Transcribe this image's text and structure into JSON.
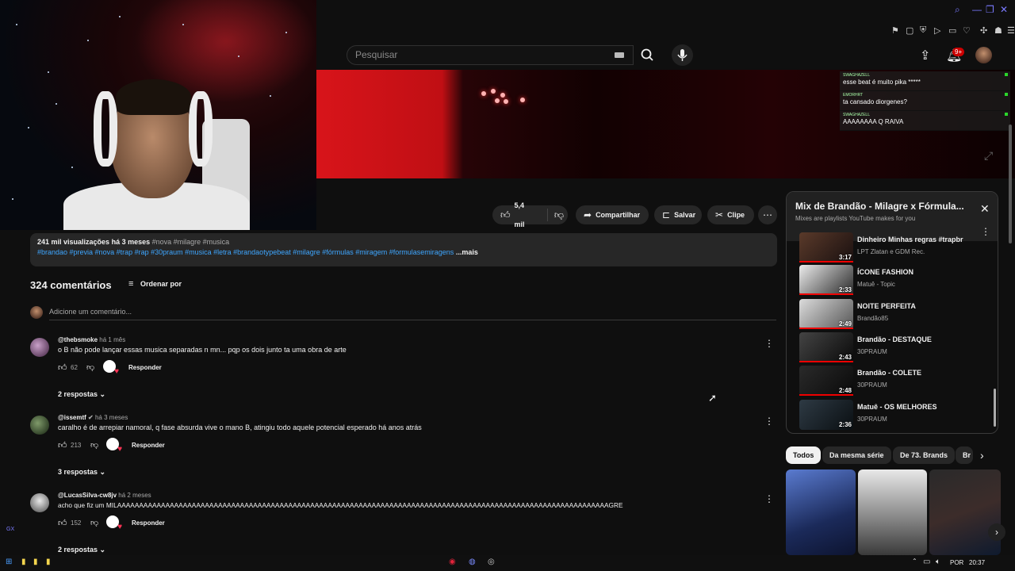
{
  "header": {
    "search_placeholder": "Pesquisar",
    "notification_count": "9+"
  },
  "chat_overlay": [
    {
      "user": "SWAGHAZELL",
      "text": "esse beat é muito pika *****"
    },
    {
      "user": "EMORHRT",
      "text": "ta cansado diorgenes?"
    },
    {
      "user": "SWAGHAZELL",
      "text": "AAAAAAAA Q RAIVA"
    }
  ],
  "actions": {
    "like_count": "5,4 mil",
    "share": "Compartilhar",
    "save": "Salvar",
    "clip": "Clipe"
  },
  "description": {
    "views": "241 mil visualizações",
    "age": "há 3 meses",
    "tags_top": "#nova #milagre #musica",
    "hashtags": "#brandao #previa #nova #trap #rap #30praum #musica #letra #brandaotypebeat #milagre #fórmulas #miragem #formulasemiragens",
    "more": "...mais"
  },
  "comments_section": {
    "count_label": "324 comentários",
    "sort_label": "Ordenar por",
    "add_placeholder": "Adicione um comentário..."
  },
  "comments": [
    {
      "user": "@thebsmoke",
      "ago": "há 1 mês",
      "text": "o B não pode lançar essas musica separadas n mn... pqp os dois junto ta uma obra de arte",
      "likes": "62",
      "reply_label": "Responder",
      "replies_label": "2 respostas"
    },
    {
      "user": "@issemtf",
      "ago": "há 3 meses",
      "text": "caralho é de arrepiar namoral, q fase absurda vive o mano B, atingiu todo aquele potencial esperado há anos atrás",
      "likes": "213",
      "reply_label": "Responder",
      "replies_label": "3 respostas"
    },
    {
      "user": "@LucasSilva-cw8jv",
      "ago": "há 2 meses",
      "text": "acho que fiz um MILAAAAAAAAAAAAAAAAAAAAAAAAAAAAAAAAAAAAAAAAAAAAAAAAAAAAAAAAAAAAAAAAAAAAAAAAAAAAAAAAAAAAAAAAAAAAAAAAAAAAAAAAAAAAAAAAGRE",
      "likes": "152",
      "reply_label": "Responder",
      "replies_label": "2 respostas"
    }
  ],
  "playlist": {
    "title": "Mix de Brandão - Milagre x Fórmula...",
    "subtitle": "Mixes are playlists YouTube makes for you",
    "items": [
      {
        "title": "Dinheiro Minhas regras #trapbr",
        "channel": "LPT Zlatan e GDM Rec.",
        "duration": "3:17"
      },
      {
        "title": "ÍCONE FASHION",
        "channel": "Matuê - Topic",
        "duration": "2:33"
      },
      {
        "title": "NOITE PERFEITA",
        "channel": "Brandão85",
        "duration": "2:49"
      },
      {
        "title": "Brandão - DESTAQUE",
        "channel": "30PRAUM",
        "duration": "2:43"
      },
      {
        "title": "Brandão - COLETE",
        "channel": "30PRAUM",
        "duration": "2:48"
      },
      {
        "title": "Matuê - OS MELHORES",
        "channel": "30PRAUM",
        "duration": "2:36"
      }
    ]
  },
  "chips": [
    "Todos",
    "Da mesma série",
    "De 73. Brands",
    "Br"
  ],
  "taskbar": {
    "lang": "POR",
    "time": "20:37"
  },
  "colors": {
    "background": "#0f0f0f",
    "surface": "#272727",
    "link": "#3ea6ff",
    "accent_red": "#cc0000"
  }
}
